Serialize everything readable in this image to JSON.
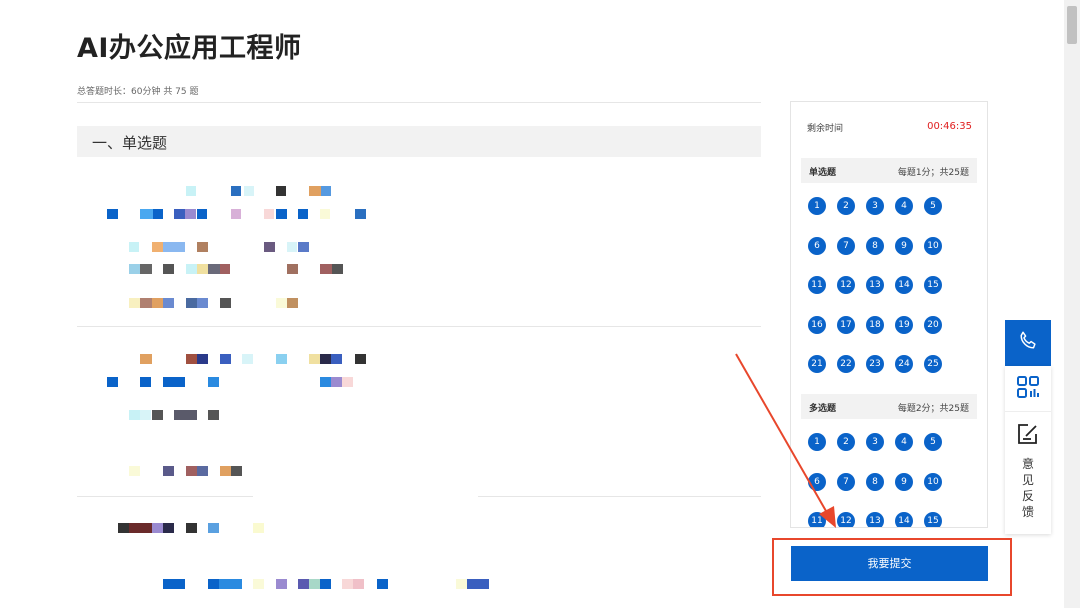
{
  "exam": {
    "title": "AI办公应用工程师",
    "meta": "总答题时长：60分钟 共 75 题"
  },
  "section": {
    "title": "一、单选题"
  },
  "panel": {
    "timer_label": "剩余时间",
    "timer_value": "00:46:35",
    "groups": [
      {
        "name": "单选题",
        "info": "每题1分；共25题",
        "numbers": [
          "1",
          "2",
          "3",
          "4",
          "5",
          "6",
          "7",
          "8",
          "9",
          "10",
          "11",
          "12",
          "13",
          "14",
          "15",
          "16",
          "17",
          "18",
          "19",
          "20",
          "21",
          "22",
          "23",
          "24",
          "25"
        ]
      },
      {
        "name": "多选题",
        "info": "每题2分；共25题",
        "numbers": [
          "1",
          "2",
          "3",
          "4",
          "5",
          "6",
          "7",
          "8",
          "9",
          "10",
          "11",
          "12",
          "13",
          "14",
          "15"
        ]
      }
    ]
  },
  "submit": {
    "label": "我要提交"
  },
  "side": {
    "feedback_label": "意见反馈",
    "icons": [
      "phone-icon",
      "qrcode-icon",
      "feedback-edit-icon"
    ]
  },
  "colors": {
    "primary": "#0a63c9",
    "timer": "#e02020",
    "annotation": "#e8472c"
  }
}
